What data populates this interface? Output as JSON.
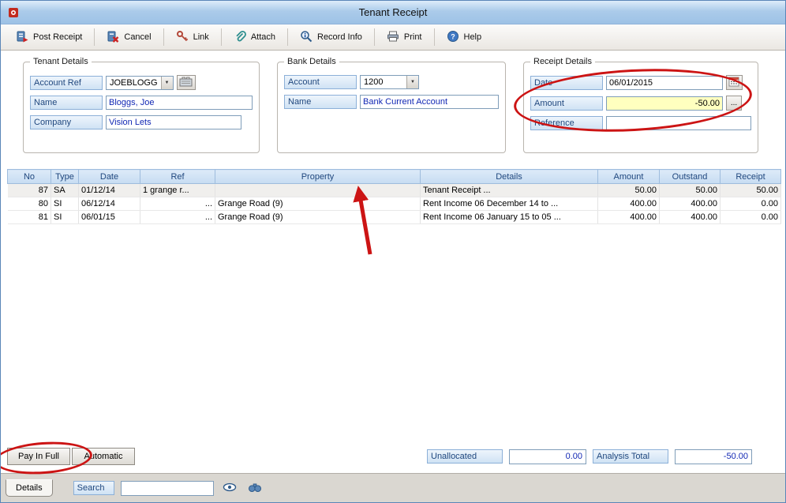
{
  "window": {
    "title": "Tenant Receipt"
  },
  "toolbar": {
    "buttons": [
      {
        "label": "Post Receipt",
        "icon": "post-receipt-icon"
      },
      {
        "label": "Cancel",
        "icon": "cancel-icon"
      },
      {
        "label": "Link",
        "icon": "link-icon"
      },
      {
        "label": "Attach",
        "icon": "attach-icon"
      },
      {
        "label": "Record Info",
        "icon": "record-info-icon"
      },
      {
        "label": "Print",
        "icon": "print-icon"
      },
      {
        "label": "Help",
        "icon": "help-icon"
      }
    ]
  },
  "tenant_details": {
    "title": "Tenant Details",
    "account_ref_label": "Account Ref",
    "account_ref_value": "JOEBLOGG",
    "name_label": "Name",
    "name_value": "Bloggs, Joe",
    "company_label": "Company",
    "company_value": "Vision Lets"
  },
  "bank_details": {
    "title": "Bank Details",
    "account_label": "Account",
    "account_value": "1200",
    "name_label": "Name",
    "name_value": "Bank Current Account"
  },
  "receipt_details": {
    "title": "Receipt Details",
    "date_label": "Date",
    "date_value": "06/01/2015",
    "amount_label": "Amount",
    "amount_value": "-50.00",
    "amount_browse": "...",
    "reference_label": "Reference",
    "reference_value": ""
  },
  "table": {
    "headers": [
      "No",
      "Type",
      "Date",
      "Ref",
      "Property",
      "Details",
      "Amount",
      "Outstand",
      "Receipt"
    ],
    "rows": [
      [
        "87",
        "SA",
        "01/12/14",
        "1 grange r...",
        "",
        "Tenant Receipt ...",
        "50.00",
        "50.00",
        "50.00"
      ],
      [
        "80",
        "SI",
        "06/12/14",
        "...",
        "Grange Road (9)",
        "Rent Income 06 December 14 to ...",
        "400.00",
        "400.00",
        "0.00"
      ],
      [
        "81",
        "SI",
        "06/01/15",
        "...",
        "Grange Road (9)",
        "Rent Income 06 January 15 to 05 ...",
        "400.00",
        "400.00",
        "0.00"
      ]
    ]
  },
  "footer": {
    "pay_in_full_label": "Pay In Full",
    "automatic_label": "Automatic",
    "unallocated_label": "Unallocated",
    "unallocated_value": "0.00",
    "analysis_total_label": "Analysis Total",
    "analysis_total_value": "-50.00"
  },
  "statusbar": {
    "details_tab_label": "Details",
    "search_label": "Search",
    "search_value": ""
  },
  "colors": {
    "accent_blue": "#1f477e",
    "annotation_red": "#cc1414",
    "amount_highlight": "#ffffbf"
  }
}
